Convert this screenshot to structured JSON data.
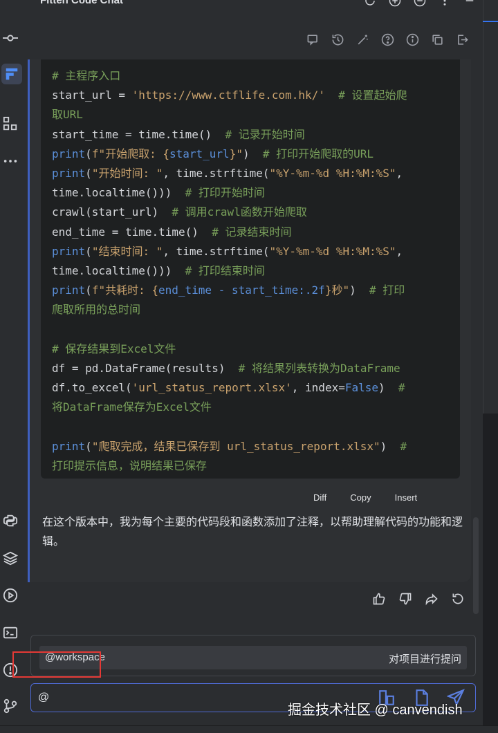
{
  "panel": {
    "title": "Fitten Code Chat"
  },
  "code_lines": [
    [
      {
        "t": "# 主程序入口",
        "c": "cm"
      }
    ],
    [
      {
        "t": "start_url = ",
        "c": ""
      },
      {
        "t": "'https://www.ctflife.com.hk/'",
        "c": "st"
      },
      {
        "t": "  # 设置起始爬",
        "c": "cm"
      }
    ],
    [
      {
        "t": "取URL",
        "c": "cm"
      }
    ],
    [
      {
        "t": "start_time = time.time()  ",
        "c": ""
      },
      {
        "t": "# 记录开始时间",
        "c": "cm"
      }
    ],
    [
      {
        "t": "print",
        "c": "kw"
      },
      {
        "t": "(",
        "c": ""
      },
      {
        "t": "f\"开始爬取: {",
        "c": "st"
      },
      {
        "t": "start_url",
        "c": "bl"
      },
      {
        "t": "}\"",
        "c": "st"
      },
      {
        "t": ")  ",
        "c": ""
      },
      {
        "t": "# 打印开始爬取的URL",
        "c": "cm"
      }
    ],
    [
      {
        "t": "print",
        "c": "kw"
      },
      {
        "t": "(",
        "c": ""
      },
      {
        "t": "\"开始时间: \"",
        "c": "st"
      },
      {
        "t": ", time.strftime(",
        "c": ""
      },
      {
        "t": "\"%Y-%m-%d %H:%M:%S\"",
        "c": "st"
      },
      {
        "t": ",",
        "c": ""
      }
    ],
    [
      {
        "t": "time.localtime()))  ",
        "c": ""
      },
      {
        "t": "# 打印开始时间",
        "c": "cm"
      }
    ],
    [
      {
        "t": "crawl(start_url)  ",
        "c": ""
      },
      {
        "t": "# 调用crawl函数开始爬取",
        "c": "cm"
      }
    ],
    [
      {
        "t": "end_time = time.time()  ",
        "c": ""
      },
      {
        "t": "# 记录结束时间",
        "c": "cm"
      }
    ],
    [
      {
        "t": "print",
        "c": "kw"
      },
      {
        "t": "(",
        "c": ""
      },
      {
        "t": "\"结束时间: \"",
        "c": "st"
      },
      {
        "t": ", time.strftime(",
        "c": ""
      },
      {
        "t": "\"%Y-%m-%d %H:%M:%S\"",
        "c": "st"
      },
      {
        "t": ",",
        "c": ""
      }
    ],
    [
      {
        "t": "time.localtime()))  ",
        "c": ""
      },
      {
        "t": "# 打印结束时间",
        "c": "cm"
      }
    ],
    [
      {
        "t": "print",
        "c": "kw"
      },
      {
        "t": "(",
        "c": ""
      },
      {
        "t": "f\"共耗时: {",
        "c": "st"
      },
      {
        "t": "end_time - start_time:.2f",
        "c": "bl"
      },
      {
        "t": "}秒\"",
        "c": "st"
      },
      {
        "t": ")  ",
        "c": ""
      },
      {
        "t": "# 打印",
        "c": "cm"
      }
    ],
    [
      {
        "t": "爬取所用的总时间",
        "c": "cm"
      }
    ],
    [
      {
        "t": "",
        "c": ""
      }
    ],
    [
      {
        "t": "# 保存结果到Excel文件",
        "c": "cm"
      }
    ],
    [
      {
        "t": "df = pd.DataFrame(results)  ",
        "c": ""
      },
      {
        "t": "# 将结果列表转换为DataFrame",
        "c": "cm"
      }
    ],
    [
      {
        "t": "df.to_excel(",
        "c": ""
      },
      {
        "t": "'url_status_report.xlsx'",
        "c": "st"
      },
      {
        "t": ", index=",
        "c": ""
      },
      {
        "t": "False",
        "c": "kw"
      },
      {
        "t": ")  ",
        "c": ""
      },
      {
        "t": "#",
        "c": "cm"
      }
    ],
    [
      {
        "t": "将DataFrame保存为Excel文件",
        "c": "cm"
      }
    ],
    [
      {
        "t": "",
        "c": ""
      }
    ],
    [
      {
        "t": "print",
        "c": "kw"
      },
      {
        "t": "(",
        "c": ""
      },
      {
        "t": "\"爬取完成，结果已保存到 url_status_report.xlsx\"",
        "c": "st"
      },
      {
        "t": ")  ",
        "c": ""
      },
      {
        "t": "#",
        "c": "cm"
      }
    ],
    [
      {
        "t": "打印提示信息，说明结果已保存",
        "c": "cm"
      }
    ]
  ],
  "code_actions": {
    "diff": "Diff",
    "copy": "Copy",
    "insert": "Insert"
  },
  "reply_text": "在这个版本中，我为每个主要的代码段和函数添加了注释，以帮助理解代码的功能和逻辑。",
  "suggestion": {
    "command": "@workspace",
    "description": "对项目进行提问"
  },
  "chat_input": {
    "value": "@"
  },
  "watermark": "掘金技术社区 @ canvendish",
  "colors": {
    "accent": "#3f5fbf",
    "highlight_box": "#e53935",
    "comment": "#79a05a",
    "string": "#c9a26d",
    "keyword": "#5b8fd9"
  }
}
